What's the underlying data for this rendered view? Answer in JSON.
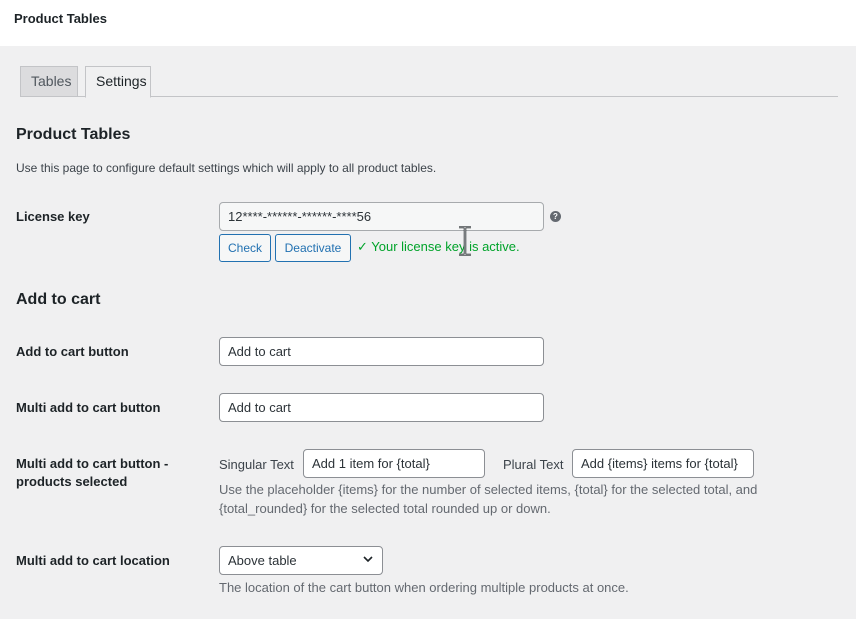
{
  "header": {
    "title": "Product Tables"
  },
  "tabs": [
    {
      "label": "Tables"
    },
    {
      "label": "Settings"
    }
  ],
  "section_main": {
    "title": "Product Tables",
    "description": "Use this page to configure default settings which will apply to all product tables."
  },
  "license": {
    "label": "License key",
    "value": "12****-******-******-****56",
    "help_icon": "?",
    "check_label": "Check",
    "deactivate_label": "Deactivate",
    "status_text": "✓ Your license key is active.",
    "status_color": "#00a32a"
  },
  "section_cart": {
    "title": "Add to cart"
  },
  "add_to_cart_button": {
    "label": "Add to cart button",
    "value": "Add to cart"
  },
  "multi_add_to_cart_button": {
    "label": "Multi add to cart button",
    "value": "Add to cart"
  },
  "multi_selected": {
    "label_line1": "Multi add to cart button -",
    "label_line2": "products selected",
    "singular_label": "Singular Text",
    "singular_value": "Add 1 item for {total}",
    "plural_label": "Plural Text",
    "plural_value": "Add {items} items for {total}",
    "hint_line1": "Use the placeholder {items} for the number of selected items, {total} for the selected total, and",
    "hint_line2": "{total_rounded} for the selected total rounded up or down."
  },
  "location": {
    "label": "Multi add to cart location",
    "selected": "Above table",
    "hint": "The location of the cart button when ordering multiple products at once."
  },
  "colors": {
    "accent": "#2271b1",
    "success": "#00a32a",
    "background": "#f0f0f1"
  }
}
